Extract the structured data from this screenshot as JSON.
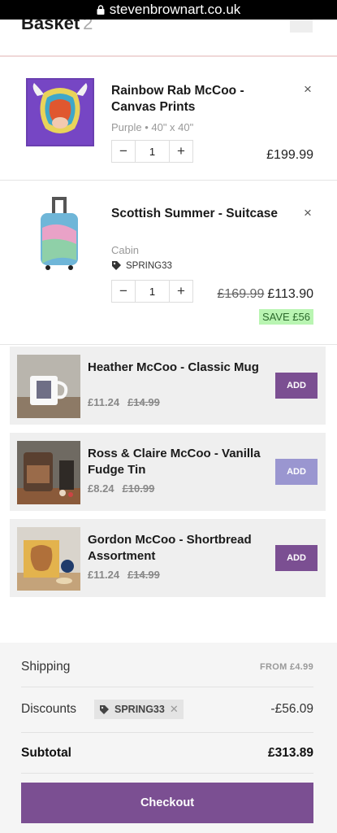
{
  "browser": {
    "url": "stevenbrownart.co.uk"
  },
  "cart": {
    "title": "Basket",
    "count": "2"
  },
  "line_items": [
    {
      "name": "Rainbow Rab McCoo - Canvas Prints",
      "variant": "Purple • 40\" x 40\"",
      "quantity": "1",
      "price": "£199.99",
      "remove": "×"
    },
    {
      "name": "Scottish Summer - Suitcase",
      "variant": "Cabin",
      "promo_code": "SPRING33",
      "quantity": "1",
      "old_price": "£169.99",
      "price": "£113.90",
      "save": "SAVE £56",
      "remove": "×"
    }
  ],
  "qty_controls": {
    "minus": "−",
    "plus": "+"
  },
  "upsells": [
    {
      "name": "Heather McCoo - Classic Mug",
      "price": "£11.24",
      "was": "£14.99",
      "button": "ADD"
    },
    {
      "name": "Ross & Claire McCoo - Vanilla Fudge Tin",
      "price": "£8.24",
      "was": "£10.99",
      "button": "ADD"
    },
    {
      "name": "Gordon McCoo - Shortbread Assortment",
      "price": "£11.24",
      "was": "£14.99",
      "button": "ADD"
    }
  ],
  "summary": {
    "shipping_label": "Shipping",
    "shipping_value": "FROM £4.99",
    "discounts_label": "Discounts",
    "discount_code": "SPRING33",
    "discount_remove": "✕",
    "discounts_value": "-£56.09",
    "subtotal_label": "Subtotal",
    "subtotal_value": "£313.89",
    "checkout": "Checkout"
  },
  "colors": {
    "accent": "#7b4f92",
    "save_bg": "#b9f5b2",
    "url_bar": "#000000"
  }
}
